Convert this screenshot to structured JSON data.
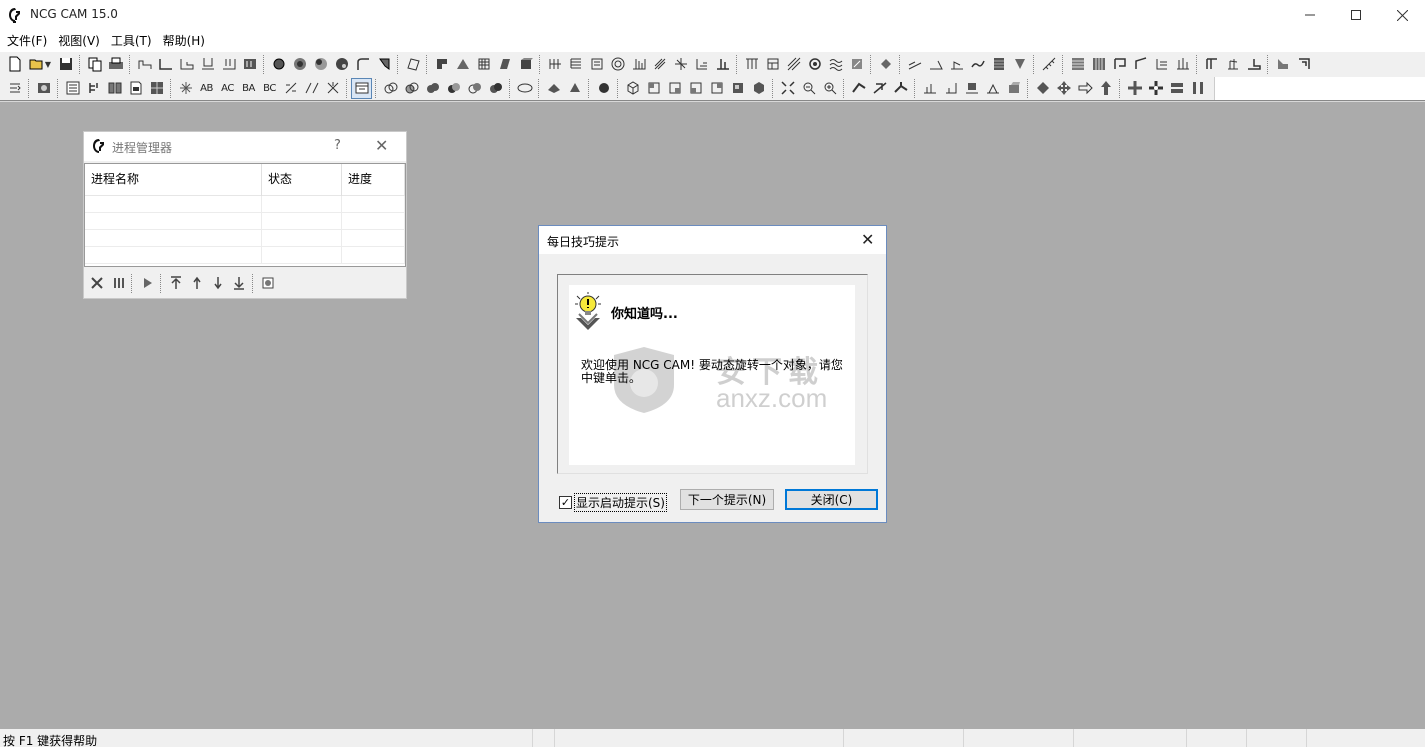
{
  "window": {
    "title": "NCG CAM 15.0",
    "minimize": "—",
    "maximize": "☐",
    "close": "✕"
  },
  "menu": {
    "items": [
      {
        "label": "文件(F)"
      },
      {
        "label": "视图(V)"
      },
      {
        "label": "工具(T)"
      },
      {
        "label": "帮助(H)"
      }
    ]
  },
  "toolbar2": {
    "ab": "AB",
    "ac": "AC",
    "ba": "BA",
    "bc": "BC"
  },
  "process_manager": {
    "title": "进程管理器",
    "help": "?",
    "close": "✕",
    "columns": [
      "进程名称",
      "状态",
      "进度"
    ]
  },
  "tip_dialog": {
    "title": "每日技巧提示",
    "close": "✕",
    "heading": "你知道吗...",
    "body": "欢迎使用 NCG CAM! 要动态旋转一个对象，请您中键单击。",
    "watermark_cn": "安下载",
    "watermark_url": "anxz.com",
    "checkbox_label": "显示启动提示(S)",
    "checkbox_checked": "✓",
    "next_button": "下一个提示(N)",
    "close_button": "关闭(C)"
  },
  "status_bar": {
    "text": "按 F1 键获得帮助"
  }
}
